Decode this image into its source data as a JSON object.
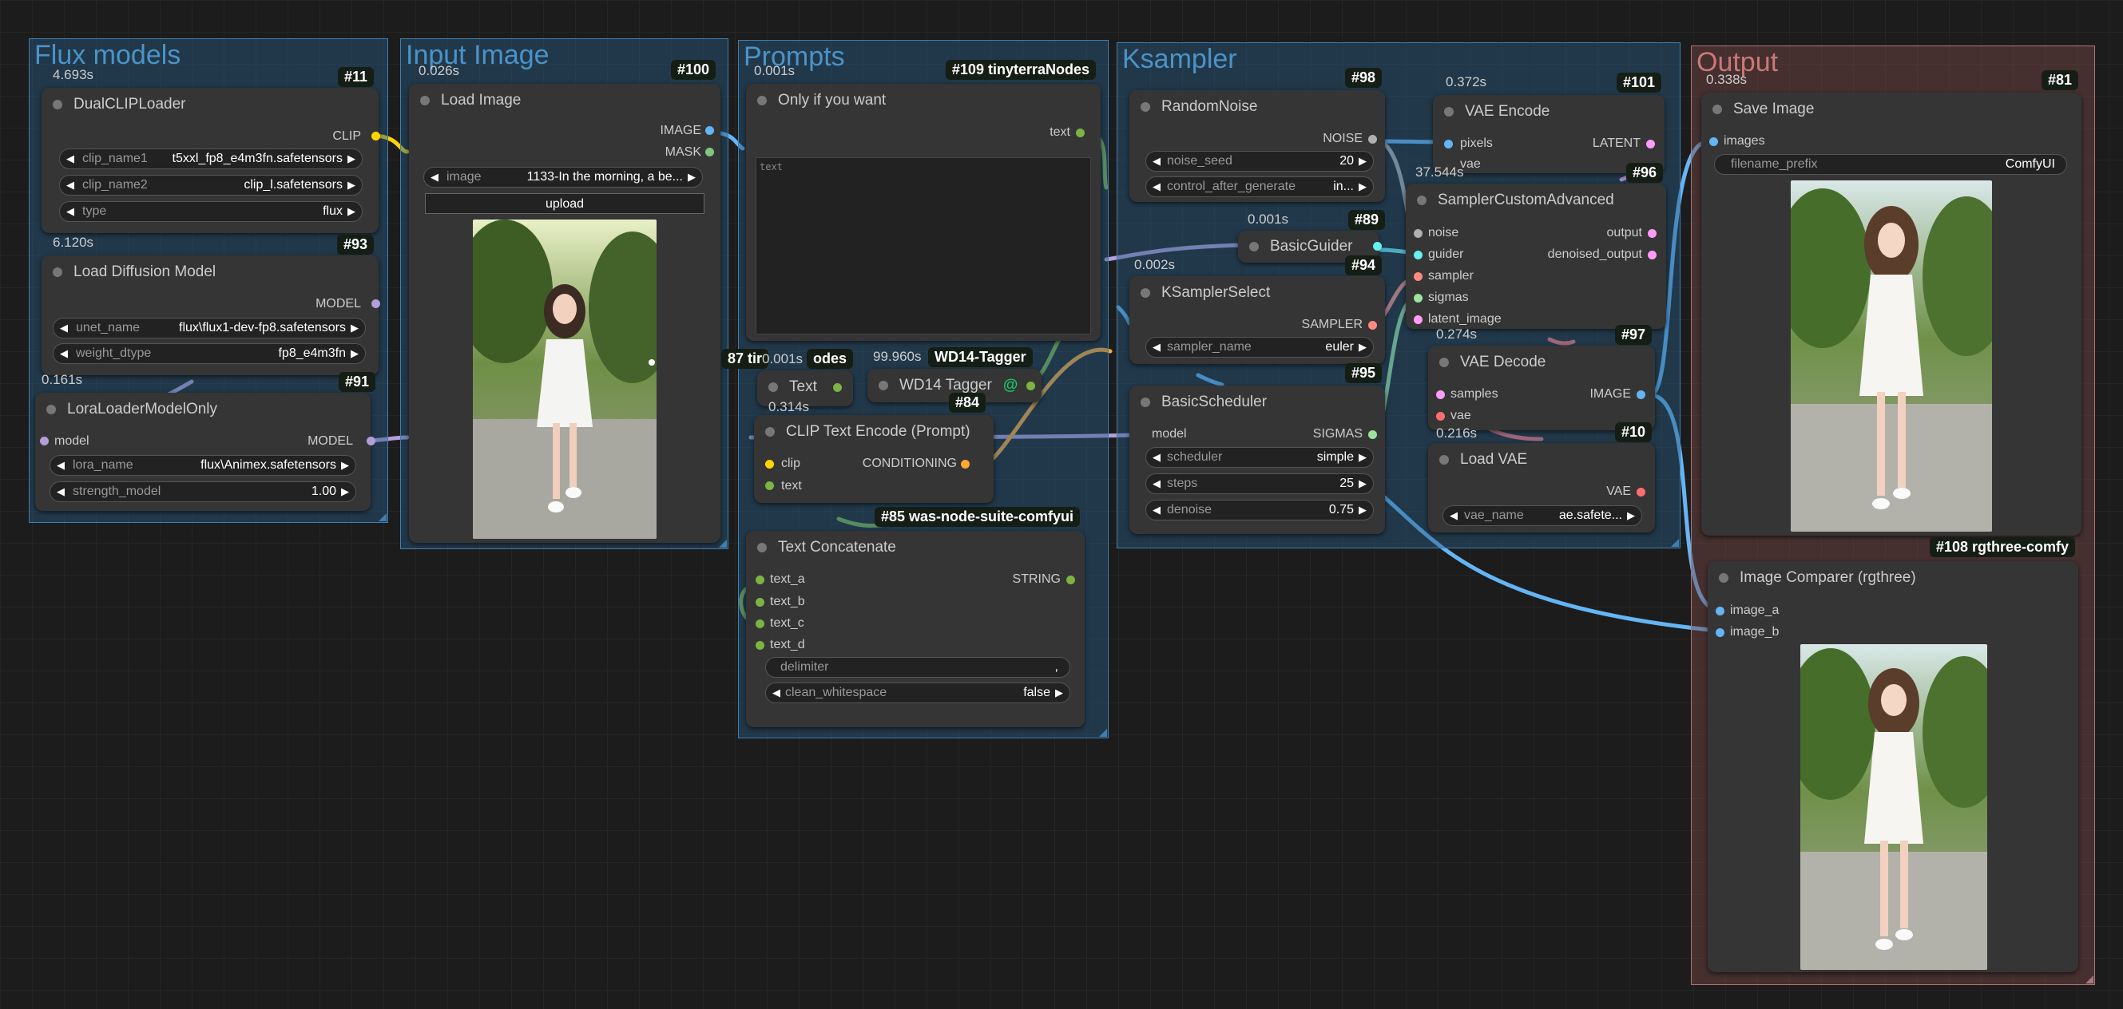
{
  "groups": {
    "flux": "Flux models",
    "input": "Input Image",
    "prompts": "Prompts",
    "ksampler": "Ksampler",
    "output": "Output"
  },
  "n11": {
    "id": "#11",
    "time": "4.693s",
    "title": "DualCLIPLoader",
    "out": "CLIP",
    "w": [
      {
        "l": "clip_name1",
        "v": "t5xxl_fp8_e4m3fn.safetensors"
      },
      {
        "l": "clip_name2",
        "v": "clip_l.safetensors"
      },
      {
        "l": "type",
        "v": "flux"
      }
    ]
  },
  "n93": {
    "id": "#93",
    "time": "6.120s",
    "title": "Load Diffusion Model",
    "out": "MODEL",
    "w": [
      {
        "l": "unet_name",
        "v": "flux\\flux1-dev-fp8.safetensors"
      },
      {
        "l": "weight_dtype",
        "v": "fp8_e4m3fn"
      }
    ]
  },
  "n91": {
    "id": "#91",
    "time": "0.161s",
    "title": "LoraLoaderModelOnly",
    "in": "model",
    "out": "MODEL",
    "w": [
      {
        "l": "lora_name",
        "v": "flux\\Animex.safetensors"
      },
      {
        "l": "strength_model",
        "v": "1.00"
      }
    ]
  },
  "n100": {
    "id": "#100",
    "time": "0.026s",
    "title": "Load Image",
    "out1": "IMAGE",
    "out2": "MASK",
    "w": [
      {
        "l": "image",
        "v": "1133-In the morning, a be..."
      }
    ],
    "upload": "upload"
  },
  "n109": {
    "id": "#109 tinyterraNodes",
    "time": "0.001s",
    "title": "Only if you want",
    "out": "text",
    "placeholder": "text"
  },
  "n87": {
    "tag": "87 tir",
    "suffix": "odes",
    "time": "0.001s",
    "title": "Text"
  },
  "wd14": {
    "time": "99.960s",
    "tag": "WD14-Tagger",
    "title": "WD14 Tagger",
    "frag": "3"
  },
  "n84": {
    "id": "#84",
    "time": "0.314s",
    "title": "CLIP Text Encode (Prompt)",
    "in1": "clip",
    "in2": "text",
    "out": "CONDITIONING"
  },
  "n85": {
    "id": "#85 was-node-suite-comfyui",
    "title": "Text Concatenate",
    "out": "STRING",
    "ins": [
      "text_a",
      "text_b",
      "text_c",
      "text_d"
    ],
    "w": [
      {
        "l": "delimiter",
        "v": ","
      },
      {
        "l": "clean_whitespace",
        "v": "false"
      }
    ]
  },
  "n98": {
    "id": "#98",
    "title": "RandomNoise",
    "out": "NOISE",
    "w": [
      {
        "l": "noise_seed",
        "v": "20"
      },
      {
        "l": "control_after_generate",
        "v": "in..."
      }
    ]
  },
  "n89": {
    "id": "#89",
    "time": "0.001s",
    "title": "BasicGuider"
  },
  "n94": {
    "id": "#94",
    "time": "0.002s",
    "title": "KSamplerSelect",
    "out": "SAMPLER",
    "w": [
      {
        "l": "sampler_name",
        "v": "euler"
      }
    ]
  },
  "n95": {
    "id": "#95",
    "title": "BasicScheduler",
    "in": "model",
    "out": "SIGMAS",
    "w": [
      {
        "l": "scheduler",
        "v": "simple"
      },
      {
        "l": "steps",
        "v": "25"
      },
      {
        "l": "denoise",
        "v": "0.75"
      }
    ]
  },
  "n101": {
    "id": "#101",
    "time": "0.372s",
    "title": "VAE Encode",
    "in1": "pixels",
    "in2": "vae",
    "out": "LATENT"
  },
  "n96": {
    "id": "#96",
    "time": "37.544s",
    "title": "SamplerCustomAdvanced",
    "ins": [
      "noise",
      "guider",
      "sampler",
      "sigmas",
      "latent_image"
    ],
    "outs": [
      "output",
      "denoised_output"
    ]
  },
  "n97": {
    "id": "#97",
    "time": "0.274s",
    "title": "VAE Decode",
    "in1": "samples",
    "in2": "vae",
    "out": "IMAGE"
  },
  "n10": {
    "id": "#10",
    "time": "0.216s",
    "title": "Load VAE",
    "out": "VAE",
    "w": [
      {
        "l": "vae_name",
        "v": "ae.safete..."
      }
    ]
  },
  "n81": {
    "id": "#81",
    "time": "0.338s",
    "title": "Save Image",
    "in": "images",
    "w": [
      {
        "l": "filename_prefix",
        "v": "ComfyUI"
      }
    ]
  },
  "n108": {
    "id": "#108 rgthree-comfy",
    "title": "Image Comparer (rgthree)",
    "in1": "image_a",
    "in2": "image_b"
  },
  "colors": {
    "clip": "#ffd500",
    "model": "#b39ddb",
    "image": "#64b5f6",
    "mask": "#81c784",
    "string": "#7cb342",
    "conditioning": "#ffa931",
    "noise": "#b0b0b0",
    "guider": "#66f0f0",
    "sampler": "#ff8a80",
    "sigmas": "#9ce29c",
    "latent": "#ff9cf9",
    "vae": "#ff6e6e"
  }
}
